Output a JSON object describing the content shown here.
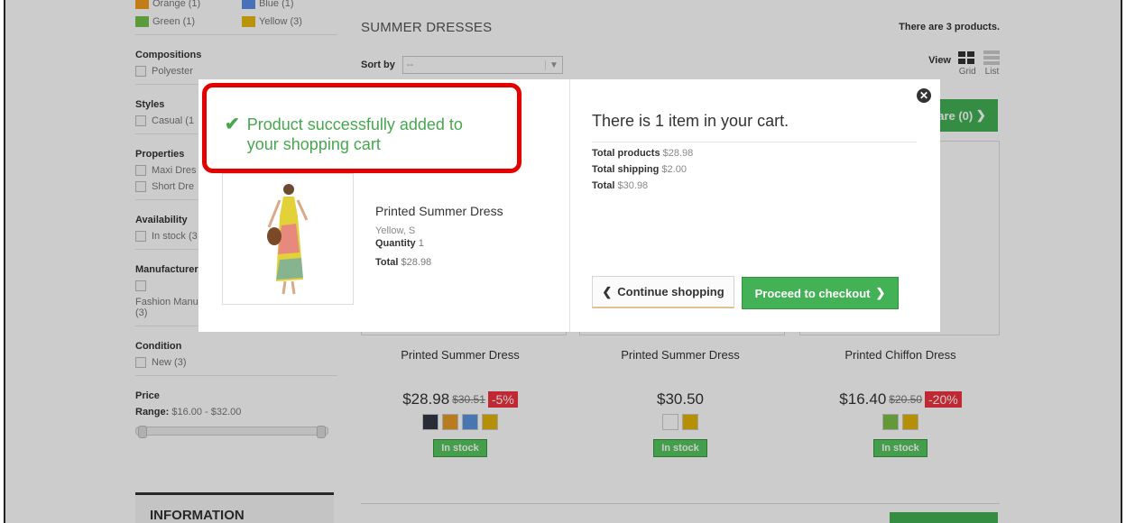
{
  "sidebar": {
    "colors": [
      {
        "label": "Orange (1)",
        "color": "#f39d1f"
      },
      {
        "label": "Blue (1)",
        "color": "#5b8ee5"
      },
      {
        "label": "Green (1)",
        "color": "#74c24a"
      },
      {
        "label": "Yellow (3)",
        "color": "#e8b90e"
      }
    ],
    "compositions_title": "Compositions",
    "compositions": [
      "Polyester"
    ],
    "styles_title": "Styles",
    "styles": [
      "Casual (1"
    ],
    "properties_title": "Properties",
    "properties": [
      "Maxi Dres",
      "Short Dre"
    ],
    "availability_title": "Availability",
    "availability": [
      "In stock (3"
    ],
    "manufacturer_title": "Manufacturer",
    "manufacturer": "Fashion Manu",
    "manufacturer_count": "(3)",
    "condition_title": "Condition",
    "condition": [
      "New (3)"
    ],
    "price_title": "Price",
    "price_range_label": "Range:",
    "price_range_value": "$16.00 - $32.00",
    "information_title": "INFORMATION"
  },
  "main": {
    "title": "SUMMER DRESSES",
    "count": "There are 3 products.",
    "sort_label": "Sort by",
    "sort_value": "--",
    "view_label": "View",
    "view_grid": "Grid",
    "view_list": "List",
    "compare_label": "are (0)",
    "products": [
      {
        "name": "Printed Summer Dress",
        "price": "$28.98",
        "old_price": "$30.51",
        "discount": "-5%",
        "colors": [
          "#333844",
          "#e89a27",
          "#5a94dd",
          "#e3b308"
        ],
        "stock": "In stock"
      },
      {
        "name": "Printed Summer Dress",
        "price": "$30.50",
        "old_price": "",
        "discount": "",
        "colors": [
          "#ffffff",
          "#e3b308"
        ],
        "stock": "In stock"
      },
      {
        "name": "Printed Chiffon Dress",
        "price": "$16.40",
        "old_price": "$20.50",
        "discount": "-20%",
        "colors": [
          "#7cc046",
          "#e3b308"
        ],
        "stock": "In stock"
      }
    ]
  },
  "modal": {
    "success_message": "Product successfully added to your shopping cart",
    "product_name": "Printed Summer Dress",
    "product_attributes": "Yellow, S",
    "quantity_label": "Quantity",
    "quantity_value": "1",
    "total_label": "Total",
    "total_value": "$28.98",
    "cart_title": "There is 1 item in your cart.",
    "total_products_label": "Total products",
    "total_products_value": "$28.98",
    "total_shipping_label": "Total shipping",
    "total_shipping_value": "$2.00",
    "cart_total_label": "Total",
    "cart_total_value": "$30.98",
    "continue_label": "Continue shopping",
    "checkout_label": "Proceed to checkout"
  },
  "colors": {
    "accent_green": "#43b155",
    "highlight_red": "#e50000",
    "success_green": "#46a74e"
  }
}
